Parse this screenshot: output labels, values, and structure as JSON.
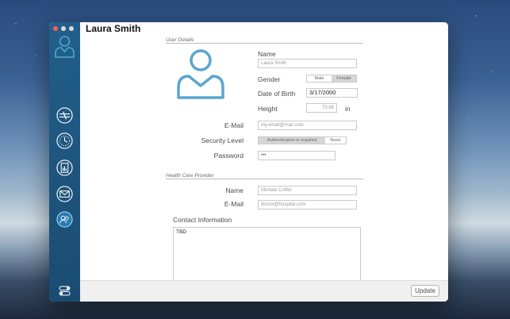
{
  "window": {
    "title": "Laura Smith"
  },
  "sidebar": {
    "items": [
      {
        "name": "syringe-icon"
      },
      {
        "name": "clock-icon"
      },
      {
        "name": "report-icon"
      },
      {
        "name": "mail-icon"
      },
      {
        "name": "user-icon"
      }
    ],
    "accent": "#2a7ab0"
  },
  "user_details": {
    "section": "User Details",
    "name_label": "Name",
    "name_placeholder": "Laura Smith",
    "gender_label": "Gender",
    "gender_options": [
      "Male",
      "Female"
    ],
    "gender_selected": "Female",
    "dob_label": "Date of Birth",
    "dob_value": "3/17/2000",
    "height_label": "Height",
    "height_placeholder": "70.86",
    "height_unit": "in",
    "email_label": "E-Mail",
    "email_placeholder": "my.email@mail.com",
    "security_label": "Security Level",
    "security_options": [
      "Authentication is required",
      "None"
    ],
    "security_selected": "Authentication is required",
    "password_label": "Password",
    "password_value": "•••"
  },
  "provider": {
    "section": "Health Care Provider",
    "name_label": "Name",
    "name_placeholder": "Michael Coffer",
    "email_label": "E-Mail",
    "email_placeholder": "doctor@hospital.com",
    "contact_label": "Contact Information",
    "contact_value": "TBD"
  },
  "footer": {
    "update_label": "Update"
  }
}
